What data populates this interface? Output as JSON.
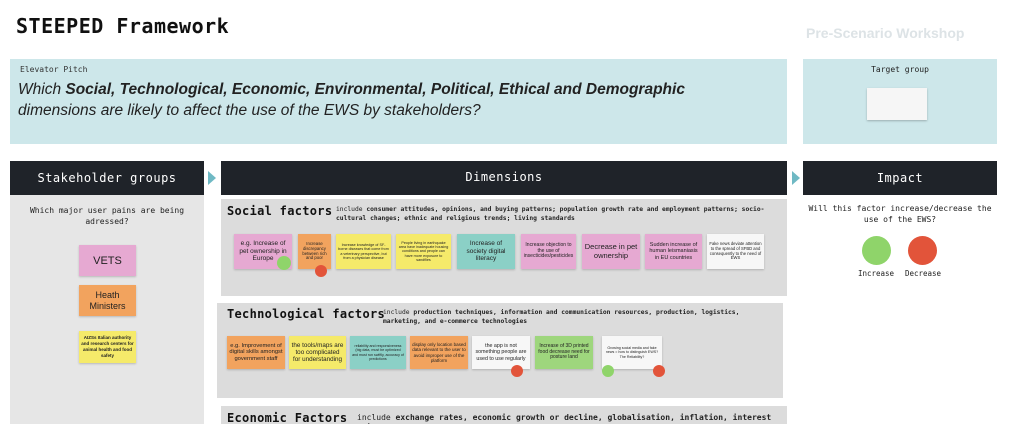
{
  "header": {
    "title": "STEEPED Framework",
    "subtitle": "Pre-Scenario Workshop"
  },
  "pitch": {
    "label": "Elevator Pitch",
    "text_a": "Which ",
    "text_b": "Social, Technological, Economic, Environmental, Political, Ethical and Demographic",
    "text_c": " dimensions are likely to affect the use of the EWS by stakeholders?"
  },
  "target": {
    "label": "Target group"
  },
  "stakeholders": {
    "header": "Stakeholder groups",
    "question": "Which major user pains are being adressed?",
    "notes": [
      {
        "text": "VETS",
        "color": "#e6a9d2"
      },
      {
        "text": "Heath Ministers",
        "color": "#f2a35e"
      },
      {
        "text": "AIZSs Italian authority and research centers for animal health and food safety",
        "color": "#f5ea6a"
      }
    ]
  },
  "dimensions": {
    "header": "Dimensions",
    "social": {
      "title": "Social factors",
      "desc_a": "include ",
      "desc_b": "consumer attitudes, opinions, and buying patterns; population growth rate and employment patterns; socio-cultural changes; ethnic and religious trends; living standards",
      "notes": [
        "e.g. Increase of pet ownership in Europe",
        "Increase discrepancy between rich and poor",
        "Increase knowledge of SF-borne diseases that come from a veterinary perspective, but from a physician disease",
        "People living in earthquake area have inadequate housing conditions and people can have more exposure to sandflies",
        "Increase of society digital literacy",
        "Increase objection to the use of insecticides/pesticides",
        "Decrease in pet ownership",
        "Sudden increase of human leismaniasis in EU countries",
        "Fake news deviate attention to the spread of SFBD and consequently to the need of EWS"
      ]
    },
    "technological": {
      "title": "Technological factors",
      "desc_a": "include ",
      "desc_b": "production techniques, information and communication resources, production, logistics, marketing, and e-commerce technologies",
      "notes": [
        "e.g. Improvement of digital skills amongst government staff",
        "the tools/maps are too complicated for understanding",
        "reliability and responsiveness (big data, must be optimized and must run swiftly, accuracy of predictions",
        "display only location based data relevant to the user to avoid improper use of the platform",
        "the app is not something people are used to use regularly",
        "Increase of 3D printed food decrease need for posture land",
        "Growing social media and fake news = how to distinguish EWS? The Reliability?"
      ]
    },
    "economic": {
      "title": "Economic Factors",
      "desc_a": "include ",
      "desc_b": "exchange rates, economic growth or decline, globalisation, inflation, interest rates"
    }
  },
  "impact": {
    "header": "Impact",
    "question": "Will this factor increase/decrease the use of the EWS?",
    "increase": "Increase",
    "decrease": "Decrease"
  },
  "colors": {
    "teal_panel": "#cde7ea",
    "header_dark": "#1f2329",
    "arrow": "#6fb9c4",
    "increase_green": "#8fd46a",
    "decrease_red": "#e2543a"
  }
}
